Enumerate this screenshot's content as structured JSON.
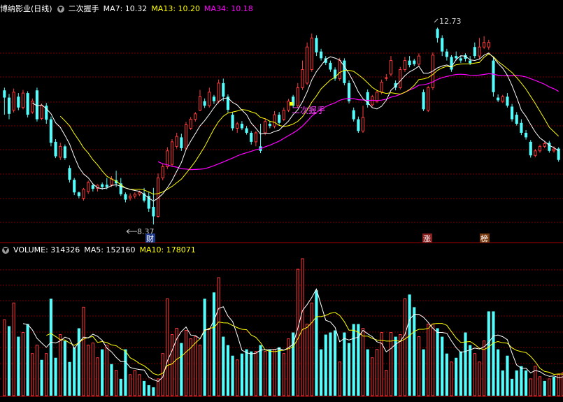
{
  "stock_header": {
    "name": "博纳影业(日线)",
    "indicator": "二次握手",
    "ma7": "MA7: 10.32",
    "ma13": "MA13: 10.20",
    "ma34": "MA34: 10.18"
  },
  "volume_header": {
    "volume": "VOLUME: 314326",
    "ma5": "MA5: 152160",
    "ma10": "MA10: 178071"
  },
  "annotations": {
    "high_label": "12.73",
    "low_label": "8.37",
    "signal_label": "二次握手",
    "marker_cai": "财",
    "marker_zhang": "涨",
    "marker_bang": "榜"
  },
  "colors": {
    "up": "#ff3c3c",
    "down": "#54fcfc",
    "ma7": "#ffffff",
    "ma13": "#ffff00",
    "ma34": "#ff00ff",
    "grid": "#7a0000"
  },
  "chart_data": [
    {
      "type": "candlestick",
      "title": "博纳影业(日线)",
      "ylim": [
        8.0,
        13.0
      ],
      "highest": 12.73,
      "lowest": 8.37,
      "candles": [
        [
          11.34,
          11.18,
          11.4,
          10.8
        ],
        [
          11.18,
          10.82,
          11.26,
          10.7
        ],
        [
          10.9,
          11.3,
          11.38,
          10.85
        ],
        [
          11.2,
          10.96,
          11.28,
          10.9
        ],
        [
          10.96,
          11.28,
          11.35,
          10.92
        ],
        [
          11.28,
          10.8,
          11.32,
          10.74
        ],
        [
          10.86,
          11.1,
          11.16,
          10.82
        ],
        [
          11.34,
          10.7,
          11.4,
          10.65
        ],
        [
          10.72,
          11.0,
          11.05,
          10.68
        ],
        [
          11.0,
          10.69,
          11.06,
          10.6
        ],
        [
          10.7,
          10.18,
          10.76,
          10.1
        ],
        [
          10.2,
          9.88,
          10.26,
          9.84
        ],
        [
          9.86,
          10.1,
          10.18,
          9.8
        ],
        [
          10.1,
          9.84,
          10.14,
          9.8
        ],
        [
          9.62,
          9.36,
          9.68,
          9.3
        ],
        [
          9.36,
          9.08,
          9.4,
          9.02
        ],
        [
          9.08,
          9.0,
          9.1,
          8.95
        ],
        [
          8.95,
          9.15,
          9.18,
          8.9
        ],
        [
          9.1,
          9.3,
          9.34,
          9.05
        ],
        [
          9.24,
          9.16,
          9.28,
          9.1
        ],
        [
          9.17,
          9.24,
          9.26,
          9.1
        ],
        [
          9.26,
          9.2,
          9.3,
          9.14
        ],
        [
          9.25,
          9.2,
          9.4,
          9.15
        ],
        [
          9.25,
          9.38,
          9.44,
          9.2
        ],
        [
          9.35,
          9.28,
          9.56,
          9.2
        ],
        [
          9.28,
          9.04,
          9.4,
          9.0
        ],
        [
          9.04,
          8.92,
          9.08,
          8.86
        ],
        [
          8.96,
          9.0,
          9.06,
          8.9
        ],
        [
          9.0,
          9.04,
          9.08,
          8.95
        ],
        [
          9.04,
          9.08,
          9.12,
          9.0
        ],
        [
          9.06,
          8.9,
          9.18,
          8.86
        ],
        [
          9.0,
          8.72,
          9.1,
          8.65
        ],
        [
          8.76,
          8.55,
          9.18,
          8.37
        ],
        [
          8.55,
          9.4,
          9.5,
          8.52
        ],
        [
          9.4,
          9.65,
          9.72,
          9.35
        ],
        [
          9.65,
          10.0,
          10.08,
          9.6
        ],
        [
          9.7,
          10.2,
          10.26,
          9.65
        ],
        [
          10.1,
          10.32,
          10.4,
          10.05
        ],
        [
          10.3,
          10.06,
          10.38,
          10.0
        ],
        [
          10.06,
          10.58,
          10.64,
          10.02
        ],
        [
          10.5,
          10.7,
          10.75,
          10.46
        ],
        [
          10.7,
          10.82,
          10.86,
          10.65
        ],
        [
          10.9,
          11.2,
          11.35,
          10.88
        ],
        [
          11.1,
          11.0,
          11.16,
          10.95
        ],
        [
          11.0,
          11.3,
          11.4,
          10.96
        ],
        [
          11.2,
          11.1,
          11.24,
          11.04
        ],
        [
          11.1,
          11.5,
          11.58,
          11.05
        ],
        [
          11.5,
          11.2,
          11.6,
          11.1
        ],
        [
          11.2,
          10.91,
          11.25,
          10.85
        ],
        [
          10.8,
          10.5,
          10.86,
          10.45
        ],
        [
          10.5,
          10.6,
          10.64,
          10.4
        ],
        [
          10.6,
          10.5,
          10.66,
          10.46
        ],
        [
          10.5,
          10.4,
          10.55,
          10.36
        ],
        [
          10.4,
          10.2,
          10.44,
          10.14
        ],
        [
          10.2,
          10.4,
          10.44,
          10.1
        ],
        [
          10.1,
          10.0,
          10.6,
          9.95
        ],
        [
          10.4,
          10.65,
          10.72,
          10.35
        ],
        [
          10.6,
          10.55,
          10.66,
          10.5
        ],
        [
          10.55,
          10.8,
          10.88,
          10.5
        ],
        [
          10.8,
          10.62,
          10.86,
          10.58
        ],
        [
          10.7,
          10.9,
          10.96,
          10.66
        ],
        [
          10.9,
          11.1,
          11.15,
          10.86
        ],
        [
          11.2,
          11.0,
          11.24,
          10.95
        ],
        [
          11.0,
          11.4,
          11.5,
          10.96
        ],
        [
          11.4,
          11.8,
          12.0,
          11.35
        ],
        [
          11.5,
          12.3,
          12.4,
          11.46
        ],
        [
          11.8,
          12.5,
          12.6,
          11.75
        ],
        [
          12.5,
          12.18,
          12.56,
          12.1
        ],
        [
          12.2,
          12.05,
          12.26,
          12.0
        ],
        [
          12.05,
          11.95,
          12.1,
          11.9
        ],
        [
          11.95,
          11.8,
          12.0,
          11.75
        ],
        [
          11.8,
          11.6,
          11.85,
          11.55
        ],
        [
          11.6,
          12.0,
          12.06,
          11.55
        ],
        [
          12.0,
          11.5,
          12.05,
          11.45
        ],
        [
          11.5,
          11.1,
          11.56,
          11.05
        ],
        [
          10.9,
          10.7,
          10.96,
          10.65
        ],
        [
          10.7,
          10.44,
          10.76,
          10.4
        ],
        [
          10.44,
          10.74,
          11.0,
          10.4
        ],
        [
          11.3,
          11.02,
          11.36,
          10.96
        ],
        [
          11.02,
          11.2,
          11.24,
          10.98
        ],
        [
          11.1,
          11.3,
          11.34,
          11.06
        ],
        [
          11.3,
          11.52,
          11.58,
          11.25
        ],
        [
          11.62,
          11.62,
          11.7,
          11.55
        ],
        [
          11.7,
          12.0,
          12.1,
          11.65
        ],
        [
          11.5,
          11.4,
          11.56,
          11.34
        ],
        [
          11.4,
          11.8,
          11.86,
          11.36
        ],
        [
          11.8,
          12.0,
          12.08,
          11.75
        ],
        [
          12.0,
          11.9,
          12.1,
          11.85
        ],
        [
          12.0,
          11.92,
          12.04,
          11.88
        ],
        [
          11.92,
          12.1,
          12.16,
          11.86
        ],
        [
          11.3,
          10.92,
          11.36,
          10.88
        ],
        [
          10.9,
          11.4,
          11.44,
          10.86
        ],
        [
          11.4,
          12.12,
          12.18,
          11.35
        ],
        [
          12.7,
          12.5,
          12.73,
          12.4
        ],
        [
          12.5,
          12.2,
          12.56,
          12.1
        ],
        [
          12.2,
          12.08,
          12.26,
          12.0
        ],
        [
          12.08,
          11.8,
          12.12,
          11.75
        ],
        [
          12.1,
          12.05,
          12.2,
          12.0
        ],
        [
          12.05,
          12.0,
          12.1,
          11.95
        ],
        [
          12.12,
          12.04,
          12.16,
          11.98
        ],
        [
          12.0,
          11.94,
          12.1,
          11.9
        ],
        [
          12.3,
          12.1,
          12.4,
          12.05
        ],
        [
          12.1,
          12.3,
          12.5,
          12.04
        ],
        [
          12.3,
          12.4,
          12.54,
          12.26
        ],
        [
          12.3,
          12.4,
          12.46,
          12.24
        ],
        [
          12.0,
          11.3,
          12.06,
          11.2
        ],
        [
          11.18,
          11.12,
          11.25,
          11.08
        ],
        [
          11.1,
          11.2,
          11.24,
          11.06
        ],
        [
          11.2,
          11.0,
          11.28,
          10.96
        ],
        [
          10.98,
          10.7,
          11.04,
          10.65
        ],
        [
          10.8,
          10.6,
          10.86,
          10.56
        ],
        [
          10.62,
          10.4,
          10.7,
          10.35
        ],
        [
          10.4,
          10.3,
          10.46,
          10.25
        ],
        [
          10.2,
          9.9,
          10.24,
          9.85
        ],
        [
          9.9,
          10.0,
          10.04,
          9.86
        ],
        [
          10.0,
          10.1,
          10.14,
          9.96
        ],
        [
          10.1,
          10.16,
          10.2,
          10.06
        ],
        [
          10.18,
          10.0,
          10.22,
          9.96
        ],
        [
          10.0,
          10.04,
          10.1,
          9.96
        ],
        [
          10.05,
          9.8,
          10.08,
          9.76
        ]
      ]
    },
    {
      "type": "bar",
      "title": "VOLUME",
      "ylim": [
        0,
        330000
      ],
      "values": [
        180000,
        165000,
        220000,
        140000,
        150000,
        170000,
        100000,
        120000,
        85000,
        100000,
        230000,
        90000,
        145000,
        130000,
        80000,
        115000,
        160000,
        210000,
        120000,
        125000,
        90000,
        110000,
        120000,
        75000,
        60000,
        40000,
        110000,
        50000,
        60000,
        50000,
        35000,
        25000,
        20000,
        40000,
        100000,
        230000,
        145000,
        160000,
        125000,
        155000,
        135000,
        140000,
        120000,
        230000,
        160000,
        245000,
        280000,
        140000,
        120000,
        95000,
        85000,
        100000,
        110000,
        105000,
        105000,
        120000,
        105000,
        110000,
        110000,
        115000,
        100000,
        135000,
        150000,
        300000,
        325000,
        170000,
        220000,
        250000,
        110000,
        145000,
        150000,
        155000,
        80000,
        150000,
        125000,
        170000,
        170000,
        160000,
        110000,
        90000,
        110000,
        150000,
        60000,
        150000,
        140000,
        145000,
        230000,
        240000,
        210000,
        140000,
        110000,
        170000,
        170000,
        160000,
        140000,
        100000,
        80000,
        90000,
        105000,
        150000,
        120000,
        100000,
        80000,
        130000,
        200000,
        200000,
        110000,
        60000,
        95000,
        40000,
        60000,
        70000,
        60000,
        40000,
        70000,
        45000,
        35000,
        40000,
        45000,
        50000,
        55000,
        45000
      ],
      "up_flags": [
        1,
        0,
        1,
        0,
        1,
        0,
        1,
        1,
        0,
        1,
        0,
        0,
        1,
        0,
        0,
        0,
        0,
        1,
        1,
        1,
        1,
        0,
        1,
        0,
        1,
        0,
        0,
        1,
        1,
        1,
        0,
        0,
        0,
        1,
        1,
        1,
        1,
        1,
        0,
        1,
        1,
        1,
        1,
        0,
        1,
        0,
        1,
        0,
        0,
        0,
        1,
        0,
        0,
        0,
        1,
        0,
        1,
        0,
        1,
        0,
        1,
        1,
        0,
        1,
        1,
        1,
        1,
        0,
        0,
        0,
        0,
        0,
        1,
        0,
        0,
        0,
        0,
        1,
        0,
        1,
        1,
        1,
        1,
        1,
        0,
        1,
        1,
        0,
        0,
        1,
        0,
        1,
        1,
        0,
        0,
        0,
        1,
        0,
        0,
        0,
        0,
        1,
        1,
        1,
        0,
        0,
        0,
        0,
        0,
        0,
        0,
        0,
        0,
        1,
        1,
        1,
        0,
        1,
        0,
        1,
        1,
        0
      ]
    }
  ]
}
